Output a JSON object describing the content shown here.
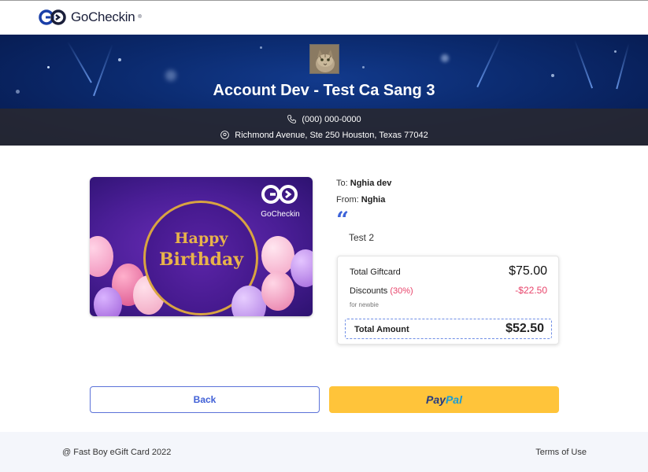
{
  "header": {
    "brand": "GoCheckin"
  },
  "store": {
    "name": "Account Dev - Test Ca Sang 3",
    "phone": "(000) 000-0000",
    "address": "Richmond Avenue, Ste 250 Houston, Texas 77042"
  },
  "giftcard": {
    "brand": "GoCheckin",
    "line1": "Happy",
    "line2": "Birthday"
  },
  "details": {
    "to_label": "To:",
    "to_name": "Nghia dev",
    "from_label": "From:",
    "from_name": "Nghia",
    "message": "Test 2"
  },
  "summary": {
    "total_giftcard_label": "Total Giftcard",
    "total_giftcard_value": "$75.00",
    "discounts_label": "Discounts",
    "discounts_percent": "(30%)",
    "discounts_value": "-$22.50",
    "discounts_note": "for newbie",
    "total_amount_label": "Total Amount",
    "total_amount_value": "$52.50"
  },
  "actions": {
    "back_label": "Back",
    "paypal_part1": "Pay",
    "paypal_part2": "Pal"
  },
  "footer": {
    "copyright": "@ Fast Boy eGift Card 2022",
    "terms": "Terms of Use"
  },
  "colors": {
    "accent": "#3f5fd6",
    "discount": "#e8436a",
    "paypal_bg": "#ffc43a",
    "banner": "#0b2a6e"
  }
}
